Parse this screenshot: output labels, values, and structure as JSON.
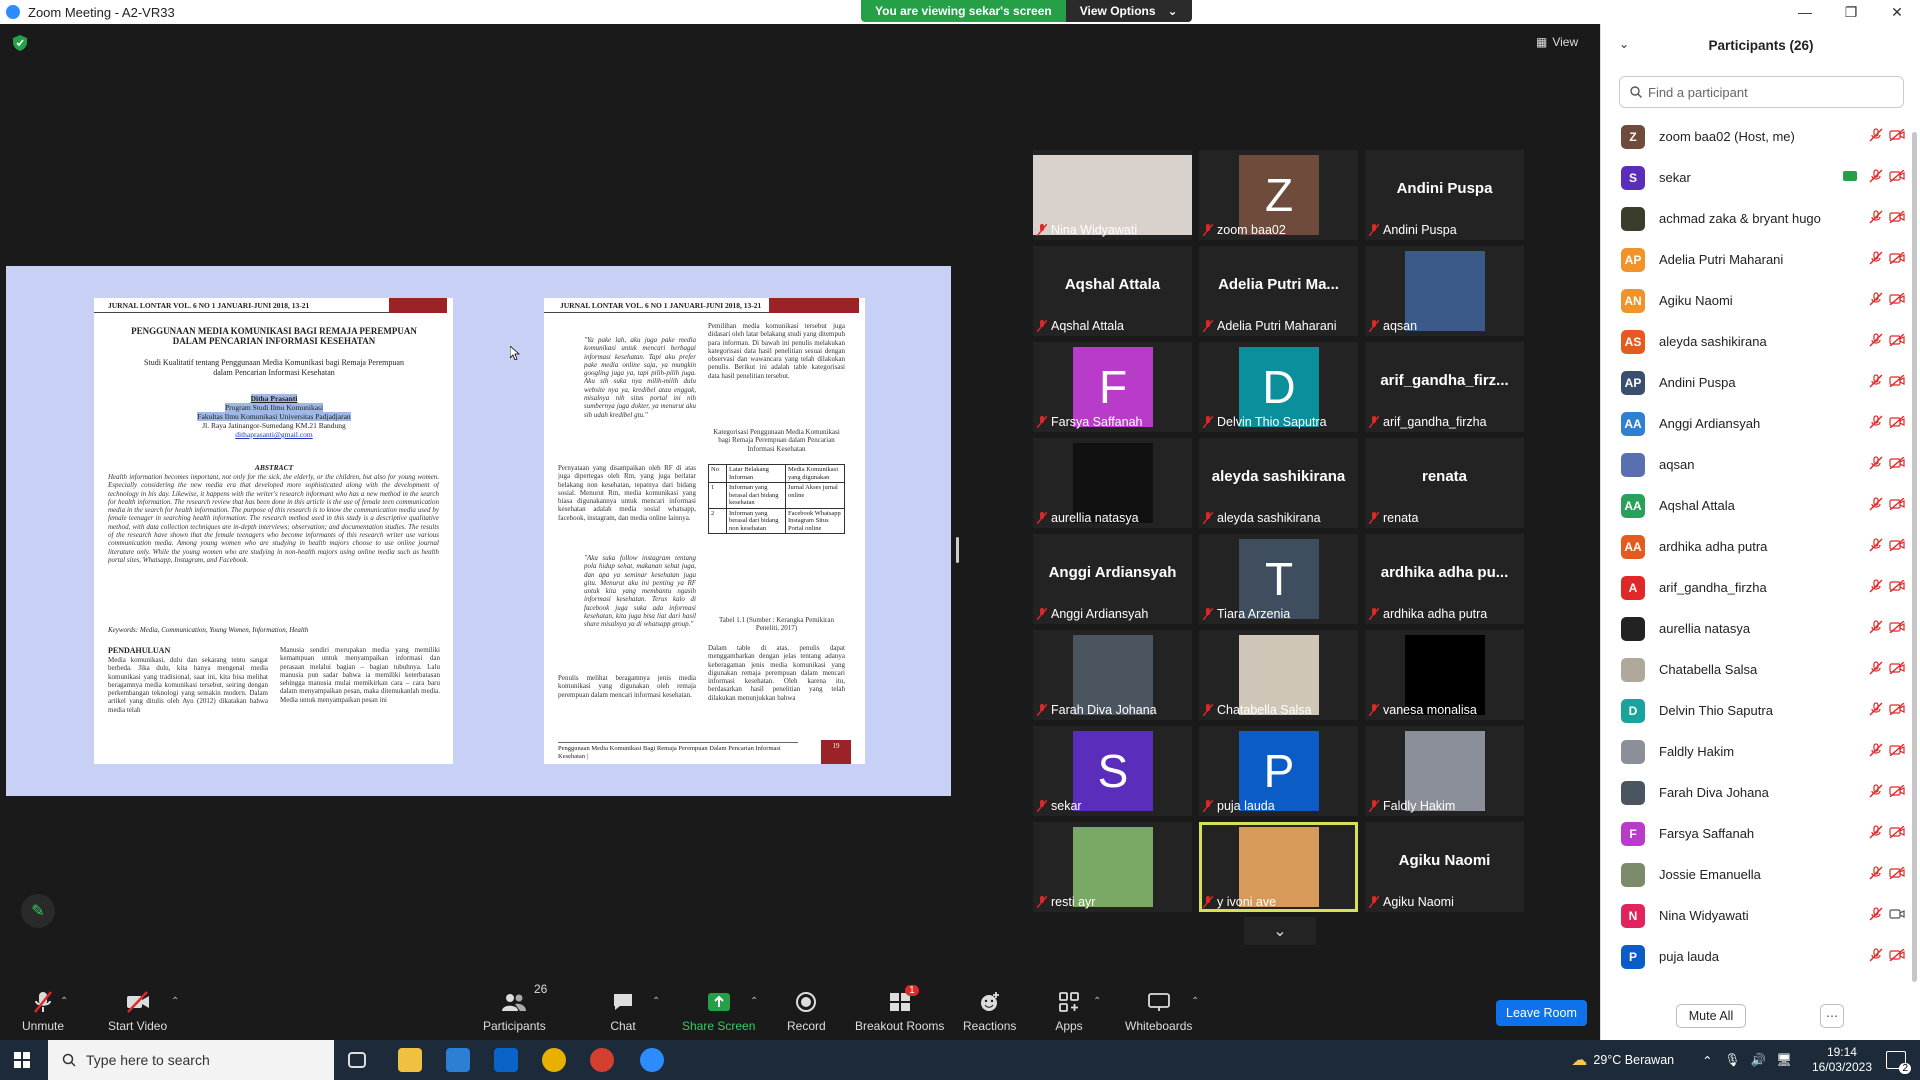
{
  "window": {
    "title": "Zoom Meeting - A2-VR33"
  },
  "banner": {
    "message": "You are viewing sekar's screen",
    "options": "View Options"
  },
  "view_button": "View",
  "doc": {
    "page1_header": "JURNAL LONTAR VOL. 6 NO 1 JANUARI-JUNI 2018, 13-21",
    "page1_title": "PENGGUNAAN MEDIA KOMUNIKASI BAGI REMAJA PEREMPUAN DALAM PENCARIAN INFORMASI KESEHATAN",
    "page1_subtitle": "Studi Kualitatif tentang Penggunaan Media Komunikasi bagi Remaja Perempuan dalam Pencarian Informasi Kesehatan",
    "author": "Ditha Prasanti",
    "affil1": "Program Studi Ilmu Komunikasi",
    "affil2": "Fakultas Ilmu Komunikasi Universitas Padjadjaran",
    "address": "Jl. Raya Jatinangor-Sumedang KM.21 Bandung",
    "email": "dithaprasanti@gmail.com",
    "abstract_heading": "ABSTRACT",
    "abstract_text": "Health information becomes important, not only for the sick, the elderly, or the children, but also for young women. Especially considering the new media era that developed more sophisticated along with the development of technology in his day. Likewise, it happens with the writer's research informant who has a new method in the search for health information. The research review that has been done in this article is the use of female teen communication media in the search for health information. The purpose of this research is to know the communication media used by female teenager in searching health information. The research method used in this study is a descriptive qualitative method, with data collection techniques are in-depth interviews; observation; and documentation studies. The results of the research have shown that the female teenagers who become informants of this research writer use various communication media. Among young women who are studying in health majors choose to use online journal literature only. While the young women who are studying in non-health majors using online media such as health portal sites, Whatsapp, Instagram, and Facebook.",
    "keywords": "Keywords: Media, Communication, Young Women, Information, Health",
    "intro_heading": "PENDAHULUAN",
    "intro_col1": "Media komunikasi, dulu dan sekarang tentu sangat berbeda. Jika dulu, kita hanya mengenal media komunikasi yang tradisional, saat ini, kita bisa melihat beragamnya media komunikasi tersebut, seiring dengan perkembangan teknologi yang semakin modern. Dalam artikel yang ditulis oleh Ayu (2012) dikatakan bahwa media telah",
    "intro_col2": "Manusia sendiri merupakan media yang memiliki kemampuan untuk menyampaikan informasi dan perasaan melalui bagian – bagian tubuhnya. Lalu manusia pun sadar bahwa ia memiliki keterbatasan sehingga manusia mulai memikirkan cara – cara baru dalam menyampaikan pesan, maka ditemukanlah media. Media untuk menyampaikan pesan ini",
    "page2_header": "JURNAL LONTAR VOL. 6 NO 1 JANUARI-JUNI 2018, 13-21",
    "page2_col1a": "\"Ya pake lah, aku juga pake media komunikasi untuk mencari berbagai informasi kesehatan. Tapi aku prefer pake media online saja, ya mungkin googling juga ya, tapi pilih-pilih juga. Aku sih suka nya milih-milih dulu website nya ya, kredibel atau enggak, misalnya nih situs portal ini nih sumbernya juga dokter, ya menurut aku sih udah kredibel gtu.\"",
    "page2_col1b": "Pernyataan yang disampaikan oleh RF di atas juga dipertegas oleh Rm, yang juga berlatar belakang non kesehatan, tepatnya dari bidang sosial. Menurut Rm, media komunikasi yang biasa digunakannya untuk mencari informasi kesehatan adalah media sosial whatsapp, facebook, instagram, dan media online lainnya.",
    "page2_col1c": "\"Aku suka follow instagram tentang pola hidup sehat, makanan sehat juga, dan apa ya seminar kesehatan juga gitu. Menurut aku ini penting ya RF untuk kita yang membantu ngasih informasi kesehatan. Terus kalo di facebook juga suka ada informasi kesehatan, kita juga bisa liat dari hasil share misalnya ya di whatsapp group.\"",
    "page2_col1d": "Penulis melihat beragamnya jenis media komunikasi yang digunakan oleh remaja perempuan dalam mencari informasi kesehatan.",
    "page2_col2a": "Pemilihan media komunikasi tersebut juga didasari oleh latar belakang studi yang ditempuh para informan. Di bawah ini penulis melakukan kategorisasi data hasil penelitian sesuai dengan observasi dan wawancara yang telah dilakukan penulis. Berikut ini adalah table kategorisasi data hasil penelitian tersebut.",
    "table_caption": "Kategorisasi Penggunaan Media Komunikasi bagi Remaja Perempuan dalam Pencarian Informasi Kesehatan",
    "table_head": [
      "No",
      "Latar Belakang Informan",
      "Media Komunikasi yang digunakan"
    ],
    "table_rows": [
      [
        "1",
        "Informan yang berasal dari bidang kesehatan",
        "Jurnal Akses jurnal online"
      ],
      [
        "2",
        "Informan yang berasal dari bidang non kesehatan",
        "Facebook Whatsapp Instagram Situs Portal online"
      ]
    ],
    "table_note": "Tabel 1.1 (Sumber : Kerangka Pemikiran Peneliti, 2017)",
    "page2_col2b": "Dalam table di atas, penulis dapat menggambarkan dengan jelas tentang adanya keberagaman jenis media komunikasi yang digunakan remaja perempuan dalam mencari informasi kesehatan. Oleh karena itu, berdasarkan hasil penelitian yang telah dilakukan menunjukkan bahwa",
    "page2_footer": "Penggunaan Media Komunikasi Bagi Remaja Perempuan Dalam Pencarian Informasi Kesehatan |",
    "page2_number": "19"
  },
  "gallery": [
    {
      "name": "Nina Widyawati",
      "kind": "photo",
      "color": "#d9d1cc"
    },
    {
      "name": "zoom baa02",
      "kind": "letter",
      "letter": "Z",
      "color": "#6e4b3a"
    },
    {
      "name": "Andini Puspa",
      "kind": "text",
      "big": "Andini Puspa"
    },
    {
      "name": "Aqshal Attala",
      "kind": "text",
      "big": "Aqshal Attala"
    },
    {
      "name": "Adelia Putri Maharani",
      "kind": "text",
      "big": "Adelia Putri Ma..."
    },
    {
      "name": "aqsan",
      "kind": "photo",
      "color": "#3b5a8a"
    },
    {
      "name": "Farsya Saffanah",
      "kind": "letter",
      "letter": "F",
      "color": "#b83cc9"
    },
    {
      "name": "Delvin Thio Saputra",
      "kind": "letter",
      "letter": "D",
      "color": "#0c8f9c"
    },
    {
      "name": "arif_gandha_firzha",
      "kind": "text",
      "big": "arif_gandha_firz..."
    },
    {
      "name": "aurellia natasya",
      "kind": "photo",
      "color": "#111111"
    },
    {
      "name": "aleyda sashikirana",
      "kind": "text",
      "big": "aleyda sashikirana"
    },
    {
      "name": "renata",
      "kind": "text",
      "big": "renata"
    },
    {
      "name": "Anggi Ardiansyah",
      "kind": "text",
      "big": "Anggi Ardiansyah"
    },
    {
      "name": "Tiara Arzenia",
      "kind": "letter",
      "letter": "T",
      "color": "#3e4e5e"
    },
    {
      "name": "ardhika adha putra",
      "kind": "text",
      "big": "ardhika adha pu..."
    },
    {
      "name": "Farah Diva Johana",
      "kind": "photo",
      "color": "#4a5560"
    },
    {
      "name": "Chatabella Salsa",
      "kind": "photo",
      "color": "#cfc6b8"
    },
    {
      "name": "vanesa monalisa",
      "kind": "photo",
      "color": "#000000"
    },
    {
      "name": "sekar",
      "kind": "letter",
      "letter": "S",
      "color": "#5b2dbb"
    },
    {
      "name": "puja lauda",
      "kind": "letter",
      "letter": "P",
      "color": "#0b5cc7"
    },
    {
      "name": "Faldly Hakim",
      "kind": "photo",
      "color": "#8a8f99"
    },
    {
      "name": "resti ayr",
      "kind": "photo",
      "color": "#7aa865"
    },
    {
      "name": "y ivoni ave",
      "kind": "photo",
      "color": "#d89a5a",
      "active": true
    },
    {
      "name": "Agiku Naomi",
      "kind": "text",
      "big": "Agiku Naomi"
    }
  ],
  "toolbar": {
    "unmute": "Unmute",
    "start_video": "Start Video",
    "participants": "Participants",
    "participants_count": "26",
    "chat": "Chat",
    "share_screen": "Share Screen",
    "record": "Record",
    "breakout_rooms": "Breakout Rooms",
    "breakout_badge": "1",
    "reactions": "Reactions",
    "apps": "Apps",
    "whiteboards": "Whiteboards",
    "leave": "Leave Room"
  },
  "panel": {
    "title": "Participants (26)",
    "search_placeholder": "Find a participant",
    "mute_all": "Mute All",
    "participants": [
      {
        "name": "zoom baa02 (Host, me)",
        "initials": "Z",
        "color": "#6e4b3a"
      },
      {
        "name": "sekar",
        "initials": "S",
        "color": "#5b2dbb",
        "sharing": true
      },
      {
        "name": "achmad zaka & bryant hugo",
        "initials": "",
        "color": "#3c3c2c"
      },
      {
        "name": "Adelia Putri Maharani",
        "initials": "AP",
        "color": "#f0932b"
      },
      {
        "name": "Agiku Naomi",
        "initials": "AN",
        "color": "#f0932b"
      },
      {
        "name": "aleyda sashikirana",
        "initials": "AS",
        "color": "#e55b1f"
      },
      {
        "name": "Andini Puspa",
        "initials": "AP",
        "color": "#3a4f6d"
      },
      {
        "name": "Anggi Ardiansyah",
        "initials": "AA",
        "color": "#2f80d1"
      },
      {
        "name": "aqsan",
        "initials": "",
        "color": "#5a6fb0"
      },
      {
        "name": "Aqshal Attala",
        "initials": "AA",
        "color": "#2aa05a"
      },
      {
        "name": "ardhika adha putra",
        "initials": "AA",
        "color": "#e55b1f"
      },
      {
        "name": "arif_gandha_firzha",
        "initials": "A",
        "color": "#e02828"
      },
      {
        "name": "aurellia natasya",
        "initials": "",
        "color": "#222222"
      },
      {
        "name": "Chatabella Salsa",
        "initials": "",
        "color": "#b0a89a"
      },
      {
        "name": "Delvin Thio Saputra",
        "initials": "D",
        "color": "#1aa39c"
      },
      {
        "name": "Faldly Hakim",
        "initials": "",
        "color": "#8a8f99"
      },
      {
        "name": "Farah Diva Johana",
        "initials": "",
        "color": "#4a5560"
      },
      {
        "name": "Farsya Saffanah",
        "initials": "F",
        "color": "#b83cc9"
      },
      {
        "name": "Jossie Emanuella",
        "initials": "",
        "color": "#7a8a6a"
      },
      {
        "name": "Nina Widyawati",
        "initials": "N",
        "color": "#e0245e",
        "video_icon": true
      },
      {
        "name": "puja lauda",
        "initials": "P",
        "color": "#0b5cc7"
      }
    ]
  },
  "taskbar": {
    "search_placeholder": "Type here to search",
    "weather": "29°C Berawan",
    "time": "19:14",
    "date": "16/03/2023",
    "notif_count": "2"
  }
}
